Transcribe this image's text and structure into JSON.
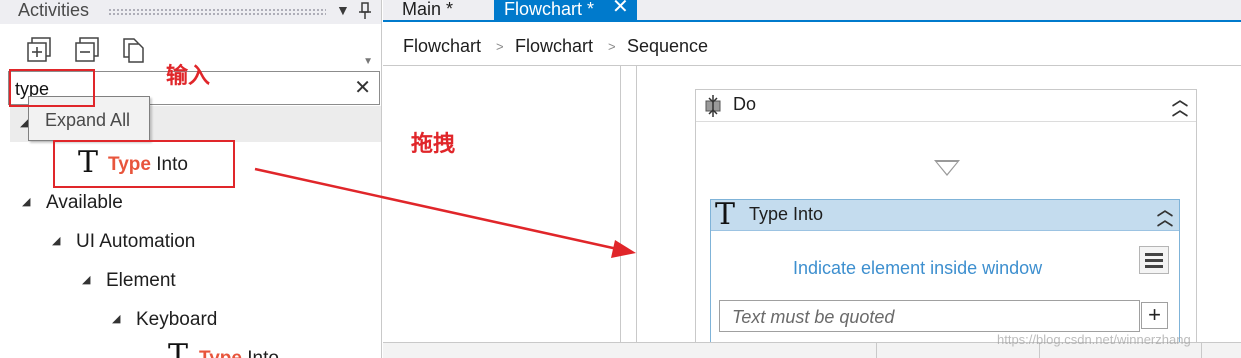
{
  "activities_pane": {
    "title": "Activities",
    "search": {
      "value": "type"
    },
    "tooltip": "Expand All",
    "recent_result": {
      "highlight": "Type",
      "rest": "Into"
    },
    "tree": {
      "available": "Available",
      "ui_automation": "UI Automation",
      "element": "Element",
      "keyboard": "Keyboard",
      "leaf": {
        "highlight": "Type",
        "rest": "Into"
      }
    },
    "toolbar_icons": [
      "expand-all-icon",
      "collapse-all-icon",
      "copy-icon"
    ]
  },
  "annotations": {
    "input_label": "输入",
    "drag_label": "拖拽",
    "color": "#e0262a"
  },
  "designer": {
    "tabs": [
      {
        "label": "Main *",
        "active": false
      },
      {
        "label": "Flowchart *",
        "active": true
      }
    ],
    "breadcrumb": [
      "Flowchart",
      "Flowchart",
      "Sequence"
    ],
    "do_activity": {
      "title": "Do"
    },
    "type_into": {
      "title": "Type Into",
      "indicate": "Indicate element inside window",
      "text_placeholder": "Text must be quoted"
    },
    "accent": "#007acc"
  },
  "watermark": "https://blog.csdn.net/winnerzhang"
}
